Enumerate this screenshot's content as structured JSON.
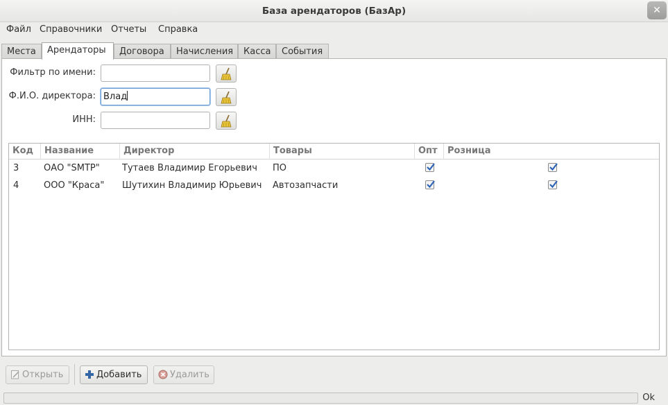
{
  "window": {
    "title": "База арендаторов (БазАр)"
  },
  "menu": [
    "Файл",
    "Справочники",
    "Отчеты",
    "Справка"
  ],
  "tabs": [
    "Места",
    "Арендаторы",
    "Договора",
    "Начисления",
    "Касса",
    "События"
  ],
  "active_tab": "Арендаторы",
  "filters": {
    "name_label": "Фильтр по имени:",
    "name_value": "",
    "director_label": "Ф.И.О. директора:",
    "director_value": "Влад",
    "inn_label": "ИНН:",
    "inn_value": ""
  },
  "table": {
    "columns": [
      "Код",
      "Название",
      "Директор",
      "Товары",
      "Опт",
      "Розница"
    ],
    "rows": [
      {
        "code": "3",
        "name": "ОАО \"SMTP\"",
        "director": "Тутаев Владимир Егорьевич",
        "goods": "ПО",
        "wholesale": true,
        "retail": true
      },
      {
        "code": "4",
        "name": "ООО \"Краса\"",
        "director": "Шутихин Владимир Юрьевич",
        "goods": "Автозапчасти",
        "wholesale": true,
        "retail": true
      }
    ]
  },
  "buttons": {
    "open": "Открыть",
    "add": "Добавить",
    "delete": "Удалить"
  },
  "status": {
    "text": "Ok"
  },
  "colors": {
    "accent": "#6b9ed6",
    "checkmark": "#2d63b8",
    "add_icon": "#3465a4",
    "delete_icon": "#c0392b"
  }
}
